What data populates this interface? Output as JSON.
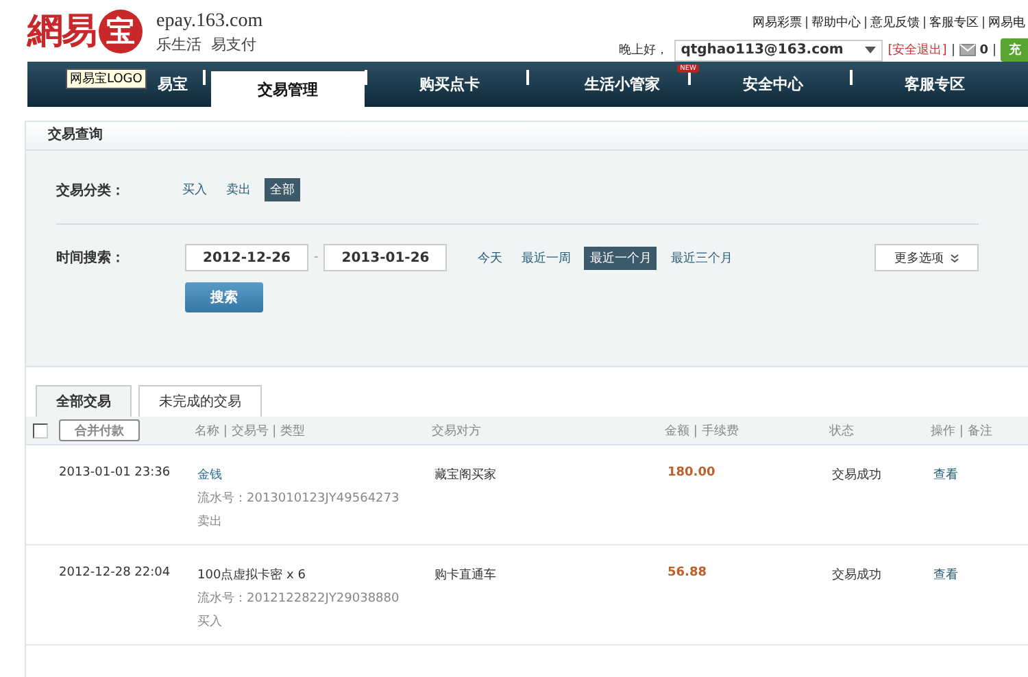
{
  "header": {
    "logo_text": "網易",
    "logo_badge": "宝",
    "domain": "epay.163.com",
    "slogan": "乐生活  易支付",
    "top_links": [
      "网易彩票",
      "帮助中心",
      "意见反馈",
      "客服专区",
      "网易电"
    ],
    "greeting": "晚上好，",
    "account": "qtghao113@163.com",
    "logout": "[安全退出]",
    "messages": "0",
    "topup": "充"
  },
  "nav": {
    "tooltip": "网易宝LOGO",
    "items": [
      {
        "label": "易宝",
        "selected": false
      },
      {
        "label": "交易管理",
        "selected": true
      },
      {
        "label": "购买点卡",
        "selected": false
      },
      {
        "label": "生活小管家",
        "selected": false,
        "badge": "NEW"
      },
      {
        "label": "安全中心",
        "selected": false
      },
      {
        "label": "客服专区",
        "selected": false
      }
    ]
  },
  "query": {
    "title": "交易查询",
    "category_label": "交易分类：",
    "categories": [
      {
        "label": "买入",
        "selected": false
      },
      {
        "label": "卖出",
        "selected": false
      },
      {
        "label": "全部",
        "selected": true
      }
    ],
    "time_label": "时间搜索：",
    "date_from": "2012-12-26",
    "date_sep": "-",
    "date_to": "2013-01-26",
    "presets": [
      {
        "label": "今天",
        "selected": false
      },
      {
        "label": "最近一周",
        "selected": false
      },
      {
        "label": "最近一个月",
        "selected": true
      },
      {
        "label": "最近三个月",
        "selected": false
      }
    ],
    "more_options": "更多选项",
    "search_button": "搜索"
  },
  "tabs": [
    {
      "label": "全部交易",
      "selected": true
    },
    {
      "label": "未完成的交易",
      "selected": false
    }
  ],
  "table": {
    "select_all_checked": false,
    "merge_button": "合并付款",
    "columns": [
      "名称 | 交易号 | 类型",
      "交易对方",
      "金额 | 手续费",
      "状态",
      "操作 | 备注"
    ],
    "rows": [
      {
        "time": "2013-01-01 23:36",
        "name": "金钱",
        "name_link": true,
        "serial": "流水号：2013010123JY49564273",
        "type": "卖出",
        "counterparty": "藏宝阁买家",
        "amount": "180.00",
        "status": "交易成功",
        "action": "查看"
      },
      {
        "time": "2012-12-28 22:04",
        "name": "100点虚拟卡密 x 6",
        "name_link": false,
        "serial": "流水号：2012122822JY29038880",
        "type": "买入",
        "counterparty": "购卡直通车",
        "amount": "56.88",
        "status": "交易成功",
        "action": "查看"
      }
    ]
  }
}
